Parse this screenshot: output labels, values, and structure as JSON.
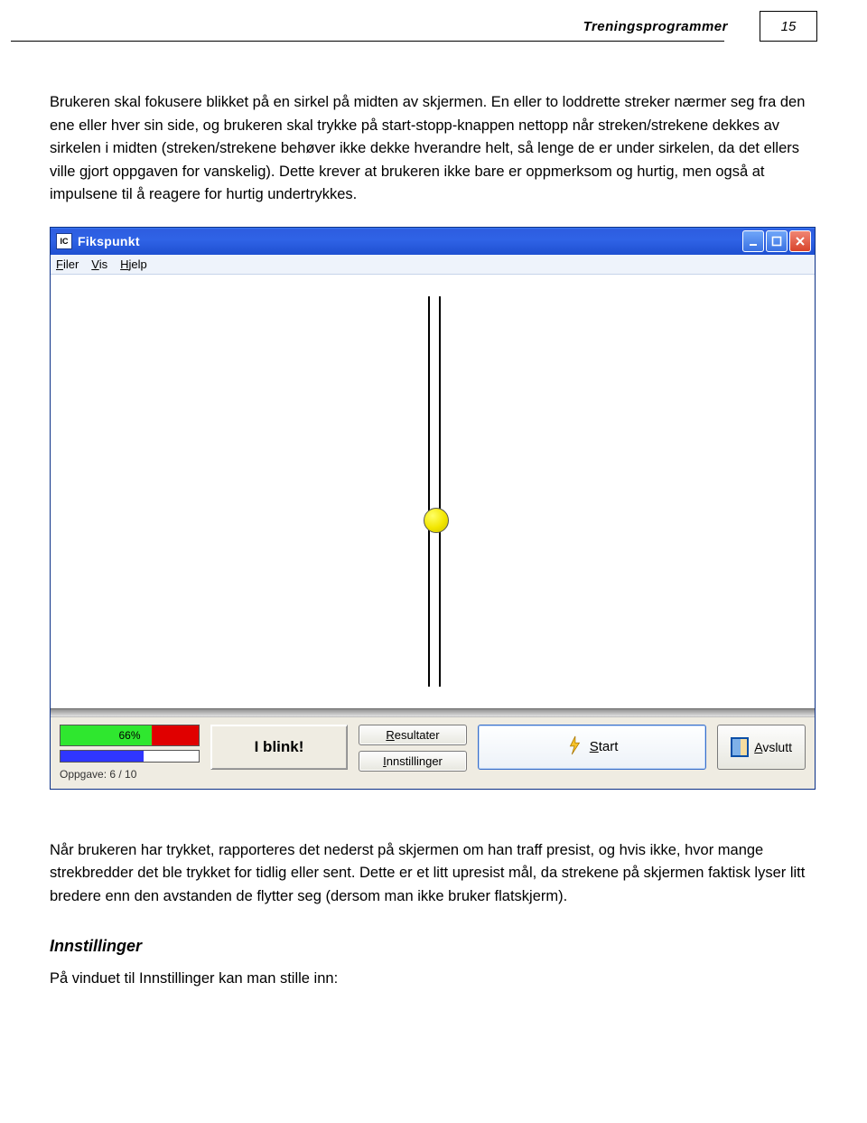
{
  "header": {
    "title": "Treningsprogrammer",
    "page_number": "15"
  },
  "body": {
    "p1": "Brukeren skal fokusere blikket på en sirkel på midten av skjermen. En eller to loddrette streker nærmer seg fra den ene eller hver sin side, og brukeren skal trykke på start-stopp-knappen nettopp når streken/strekene dekkes av sirkelen i midten (streken/strekene behøver ikke dekke hverandre helt, så lenge de er under sirkelen, da det ellers ville gjort oppgaven for vanskelig). Dette krever at brukeren ikke bare er oppmerksom og hurtig, men også at impulsene til å reagere for hurtig undertrykkes.",
    "p2": "Når brukeren har trykket, rapporteres det nederst på skjermen om han traff presist, og hvis ikke, hvor mange strekbredder det ble trykket for tidlig eller sent. Dette er et litt upresist mål, da strekene på skjermen faktisk lyser litt bredere enn den avstanden de flytter seg (dersom man ikke bruker flatskjerm).",
    "subhead": "Innstillinger",
    "p3": "På vinduet til Innstillinger kan man stille inn:"
  },
  "app": {
    "title_icon_letters": "IC",
    "title": "Fikspunkt",
    "menu": {
      "filer": "Filer",
      "vis": "Vis",
      "hjelp": "Hjelp"
    },
    "percent": {
      "value": 66,
      "label": "66%"
    },
    "progress": {
      "done": 6,
      "total": 10,
      "label": "Oppgave:  6 / 10"
    },
    "blink_label": "I blink!",
    "buttons": {
      "resultater": "Resultater",
      "innstillinger": "Innstillinger",
      "start": "Start",
      "avslutt": "Avslutt"
    }
  }
}
